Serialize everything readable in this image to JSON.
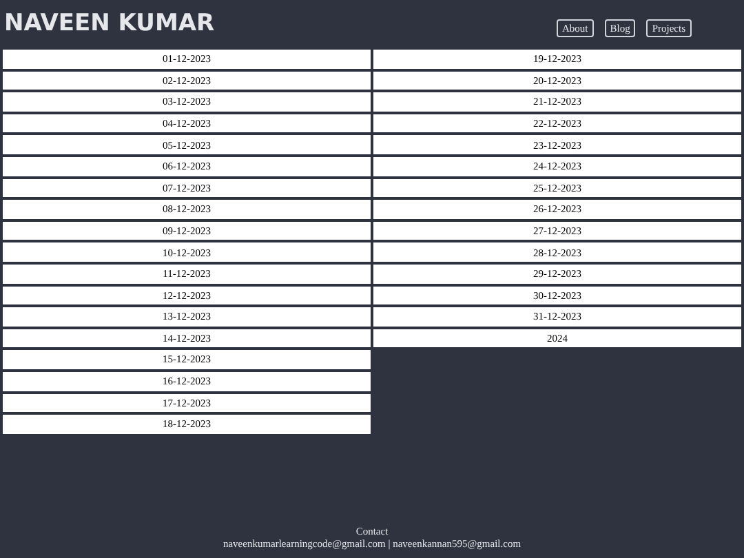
{
  "site_title": "NAVEEN KUMAR",
  "nav": [
    "About",
    "Blog",
    "Projects"
  ],
  "dates": [
    "01-12-2023",
    "02-12-2023",
    "03-12-2023",
    "04-12-2023",
    "05-12-2023",
    "06-12-2023",
    "07-12-2023",
    "08-12-2023",
    "09-12-2023",
    "10-12-2023",
    "11-12-2023",
    "12-12-2023",
    "13-12-2023",
    "14-12-2023",
    "15-12-2023",
    "16-12-2023",
    "17-12-2023",
    "18-12-2023",
    "19-12-2023",
    "20-12-2023",
    "21-12-2023",
    "22-12-2023",
    "23-12-2023",
    "24-12-2023",
    "25-12-2023",
    "26-12-2023",
    "27-12-2023",
    "28-12-2023",
    "29-12-2023",
    "30-12-2023",
    "31-12-2023",
    "2024"
  ],
  "footer": {
    "heading": "Contact",
    "emails": "naveenkumarlearningcode@gmail.com | naveenkannan595@gmail.com"
  }
}
